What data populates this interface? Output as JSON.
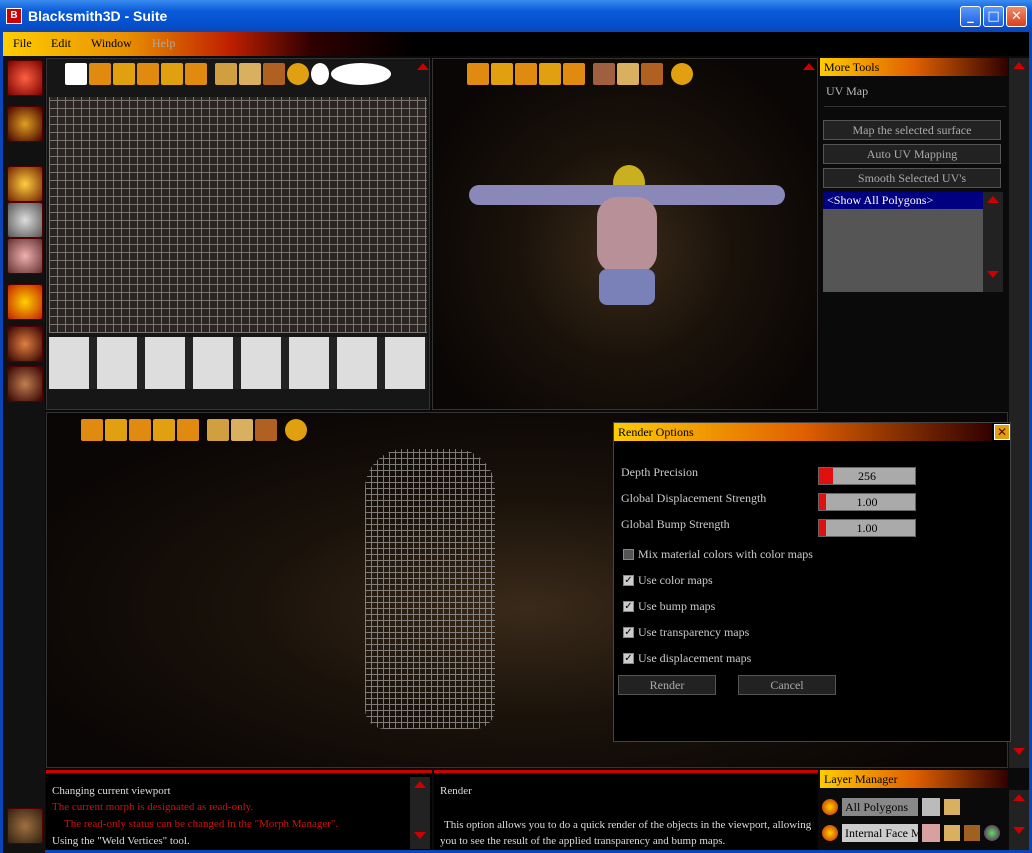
{
  "window": {
    "title": "Blacksmith3D - Suite",
    "minimize": "_",
    "maximize": "□",
    "close": "✕"
  },
  "menu": [
    "File",
    "Edit",
    "Window",
    "Help"
  ],
  "more_tools": {
    "header": "More Tools",
    "section": "UV Map",
    "buttons": [
      "Map the selected surface",
      "Auto UV Mapping",
      "Smooth Selected UV's"
    ],
    "list_items": [
      "<Show All Polygons>"
    ]
  },
  "render_options": {
    "title": "Render Options",
    "sliders": [
      {
        "label": "Depth Precision",
        "value": "256"
      },
      {
        "label": "Global Displacement Strength",
        "value": "1.00"
      },
      {
        "label": "Global Bump Strength",
        "value": "1.00"
      }
    ],
    "checkboxes": [
      {
        "label": "Mix material colors with color maps",
        "checked": false
      },
      {
        "label": "Use color maps",
        "checked": true
      },
      {
        "label": "Use bump maps",
        "checked": true
      },
      {
        "label": "Use transparency maps",
        "checked": true
      },
      {
        "label": "Use displacement maps",
        "checked": true
      }
    ],
    "render_button": "Render",
    "cancel_button": "Cancel"
  },
  "status_log": {
    "lines": [
      {
        "text": "Changing current viewport",
        "color": "#dddddd"
      },
      {
        "text": "The current morph is designated as read-only.",
        "color": "#d01010"
      },
      {
        "text": "The read-only status can be changed in the \"Morph Manager\".",
        "color": "#d01010"
      },
      {
        "text": "Using the \"Weld Vertices\" tool.",
        "color": "#dddddd"
      }
    ]
  },
  "help_panel": {
    "title": "Render",
    "text": "This option allows you to do a quick render of the objects in the viewport, allowing you to see the result of the applied transparency and bump maps."
  },
  "layer_manager": {
    "header": "Layer Manager",
    "layers": [
      "All Polygons",
      "Internal Face M"
    ]
  },
  "colors": {
    "accent": "#e01010",
    "title_blue": "#0a5ad8"
  }
}
